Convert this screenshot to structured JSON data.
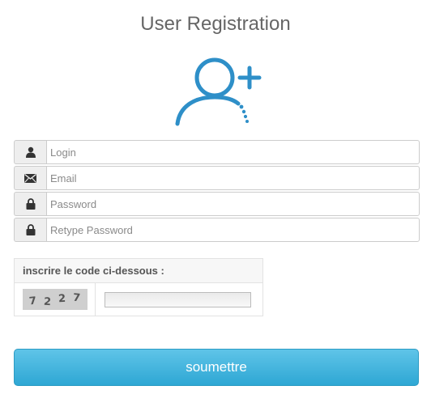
{
  "header": {
    "title": "User Registration"
  },
  "avatar": {
    "icon": "add-user-icon",
    "color": "#2e8fc8"
  },
  "form": {
    "fields": [
      {
        "icon": "user-icon",
        "placeholder": "Login",
        "value": ""
      },
      {
        "icon": "envelope-icon",
        "placeholder": "Email",
        "value": ""
      },
      {
        "icon": "lock-icon",
        "placeholder": "Password",
        "value": ""
      },
      {
        "icon": "lock-icon",
        "placeholder": "Retype Password",
        "value": ""
      }
    ]
  },
  "captcha": {
    "label": "inscrire le code ci-dessous :",
    "digits": [
      "7",
      "2",
      "2",
      "7"
    ],
    "input_value": ""
  },
  "submit": {
    "label": "soumettre",
    "color": "#3bb0dc"
  }
}
